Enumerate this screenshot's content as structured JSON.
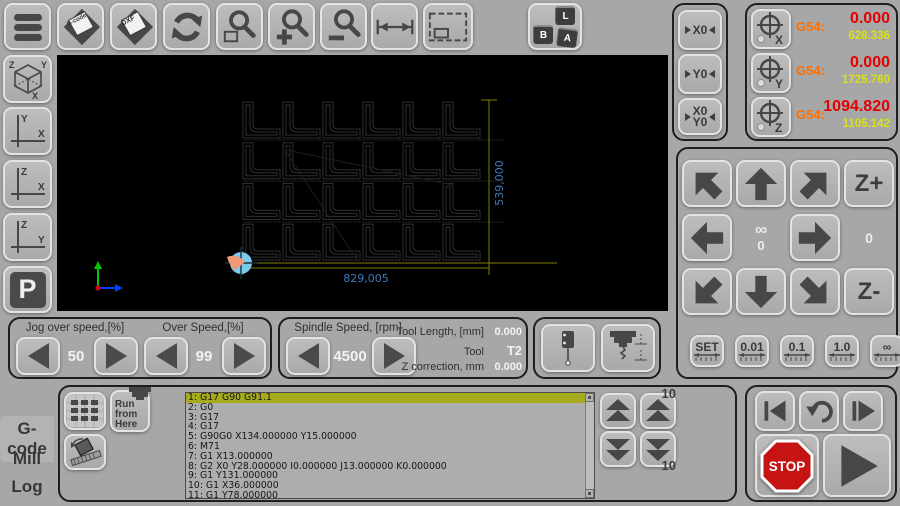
{
  "toolbar": {
    "open_gcode_label": "G-code",
    "open_dxf_label": "DXF",
    "keys": {
      "l": "L",
      "b": "B",
      "a": "A"
    }
  },
  "sidebar": {
    "view3d": {
      "z": "Z",
      "y": "Y",
      "x": "X"
    },
    "view_xy": {
      "v": "Y",
      "h": "X"
    },
    "view_xz": {
      "v": "Z",
      "h": "X"
    },
    "view_yz": {
      "v": "Z",
      "h": "Y"
    },
    "park_label": "P"
  },
  "canvas": {
    "width_dim": "829,005",
    "height_dim": "539,000",
    "grid": {
      "cols": 6,
      "rows": 4
    },
    "colors": {
      "dim_line": "#7e7e00",
      "dim_text": "#3f7ab8",
      "path": "#303030",
      "tool_marker": "#7ec8e8",
      "tool_arrow": "#f09a75"
    }
  },
  "zero_panel": {
    "x": "X0",
    "y": "Y0",
    "xy_top": "X0",
    "xy_bottom": "Y0"
  },
  "coords": {
    "rows": [
      {
        "axis": "X",
        "wcs": "G54:",
        "value": "0.000",
        "machine": "628.336"
      },
      {
        "axis": "Y",
        "wcs": "G54:",
        "value": "0.000",
        "machine": "1725.760"
      },
      {
        "axis": "Z",
        "wcs": "G54:",
        "value": "1094.820",
        "machine": "1105.142"
      }
    ],
    "colors": {
      "wcs": "#ff6f00",
      "value": "#e60000",
      "machine": "#d8e018"
    }
  },
  "jog": {
    "z_plus": "Z+",
    "z_minus": "Z-",
    "infinity": "∞",
    "zero": "0",
    "a_value": "0",
    "steps": [
      "SET",
      "0.01",
      "0.1",
      "1.0",
      "∞"
    ]
  },
  "speeds": {
    "jog_label": "Jog over speed,[%]",
    "jog_value": "50",
    "over_label": "Over Speed,[%]",
    "over_value": "99",
    "spindle_label": "Spindle Speed, [rpm]",
    "spindle_value": "4500"
  },
  "tool_info": {
    "length_label": "Tool Length, [mm]",
    "length_value": "0.000",
    "tool_label": "Tool",
    "tool_value": "T2",
    "zcorr_label": "Z correction, mm",
    "zcorr_value": "0.000"
  },
  "tabs": [
    {
      "label": "G-code",
      "selected": true
    },
    {
      "label": "Mill",
      "selected": false
    },
    {
      "label": "Log",
      "selected": false
    }
  ],
  "gcode": {
    "run_from_here": "Run from Here",
    "scroll_fast": "10",
    "selected_line": 0,
    "lines": [
      "1: G17 G90 G91.1",
      "2: G0",
      "3: G17",
      "4: G17",
      "5: G90G0 X134.000000 Y15.000000",
      "6: M71",
      "7: G1 X13.000000",
      "8: G2 X0 Y28.000000 I0.000000 J13.000000 K0.000000",
      "9: G1 Y131.000000",
      "10: G1 X36.000000",
      "11: G1 Y78.000000"
    ]
  },
  "playback": {
    "stop_label": "STOP"
  }
}
